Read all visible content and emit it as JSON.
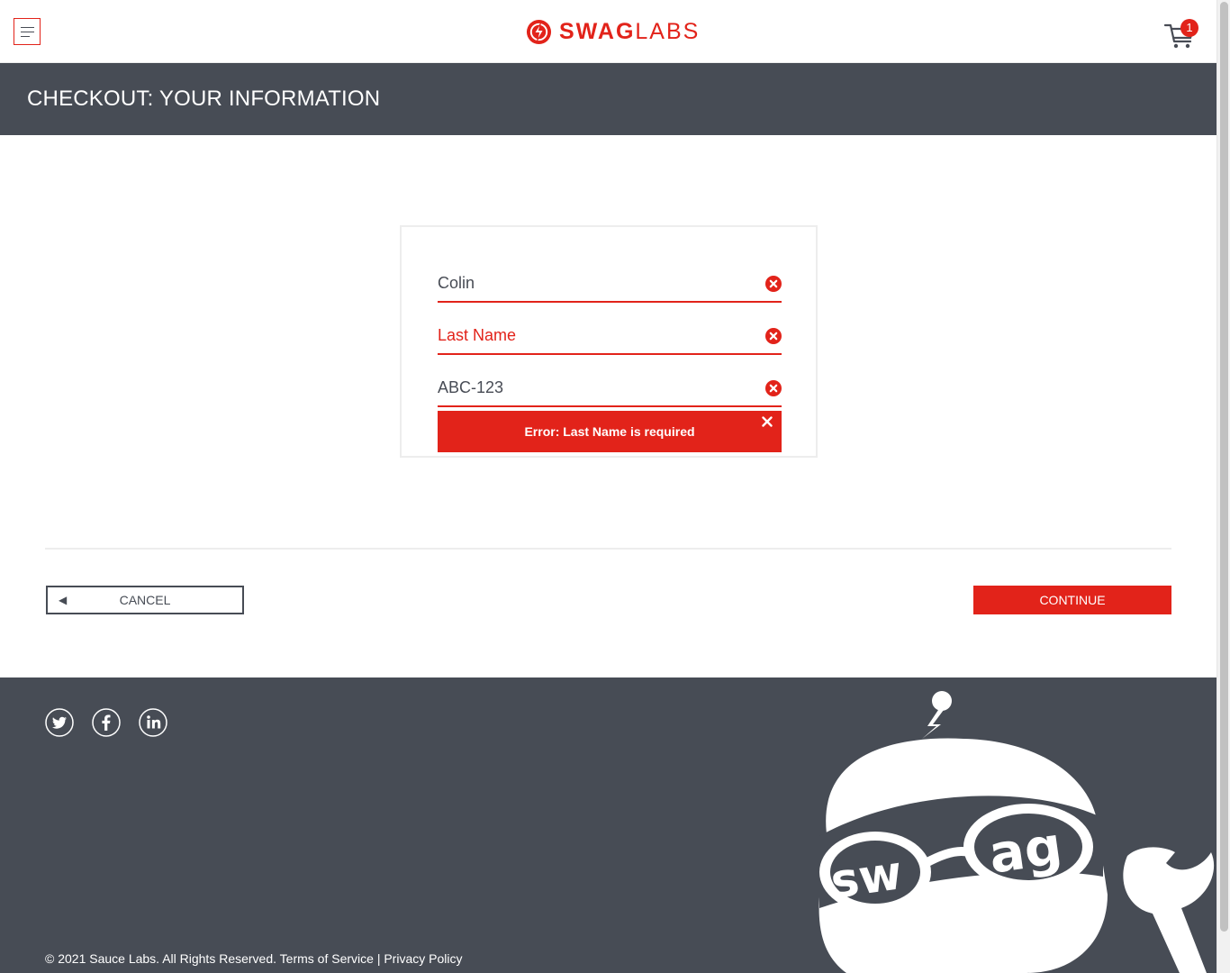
{
  "header": {
    "logo_bold": "SWAG",
    "logo_light": "LABS",
    "cart_count": "1"
  },
  "subheader": {
    "title": "CHECKOUT: YOUR INFORMATION"
  },
  "form": {
    "first_name_value": "Colin",
    "last_name_value": "",
    "last_name_placeholder": "Last Name",
    "postal_code_value": "ABC-123",
    "error_message": "Error: Last Name is required"
  },
  "actions": {
    "cancel_label": "CANCEL",
    "continue_label": "CONTINUE"
  },
  "footer": {
    "copyright": "© 2021 Sauce Labs. All Rights Reserved.",
    "terms_label": "Terms of Service",
    "separator": "|",
    "privacy_label": "Privacy Policy",
    "mascot_text": "swag"
  },
  "colors": {
    "accent": "#e2231a",
    "dark": "#474c55"
  },
  "icons": {
    "menu": "hamburger-icon",
    "cart": "cart-icon",
    "field_error": "error-circle-icon",
    "close": "close-icon",
    "back": "back-arrow-icon",
    "twitter": "twitter-icon",
    "facebook": "facebook-icon",
    "linkedin": "linkedin-icon"
  }
}
